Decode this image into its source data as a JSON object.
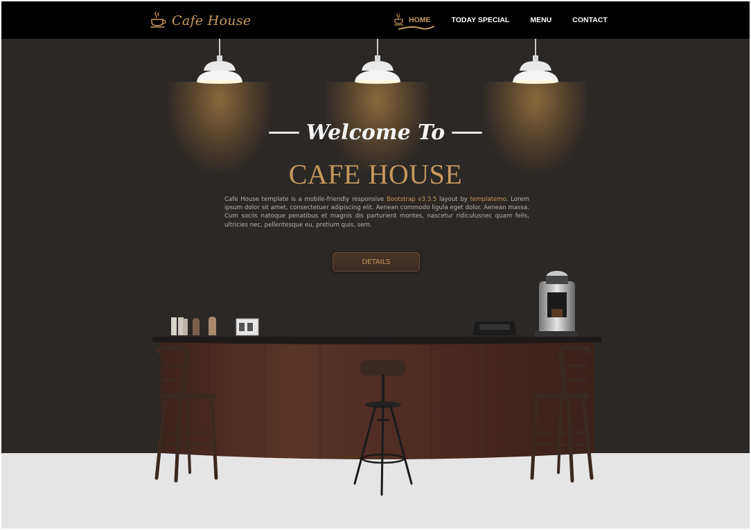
{
  "brand": {
    "name": "Cafe House",
    "icon": "coffee-cup-icon"
  },
  "nav": {
    "items": [
      {
        "label": "HOME",
        "active": true,
        "icon": "coffee-cup-icon"
      },
      {
        "label": "TODAY SPECIAL",
        "active": false
      },
      {
        "label": "MENU",
        "active": false
      },
      {
        "label": "CONTACT",
        "active": false
      }
    ]
  },
  "hero": {
    "welcome": "Welcome To",
    "title": "CAFE HOUSE",
    "desc_part1": "Cafe House template is a mobile-friendly responsive ",
    "desc_link1": "Bootstrap v3.3.5",
    "desc_part2": " layout by ",
    "desc_link2": "templatemo",
    "desc_part3": ". Lorem ipsum dolor sit amet, consectetuer adipiscing elit. Aenean commodo ligula eget dolor. Aenean massa. Cum sociis natoque penatibus et magnis dis parturient montes, nascetur ridiculusnec quam felis, ultricies nec, pellentesque eu, pretium quis, sem.",
    "button_label": "DETAILS"
  },
  "colors": {
    "accent": "#c6985e",
    "background": "#2b2826",
    "navbar": "#000000",
    "floor": "#e6e5e6",
    "counter_wood": "#4a2a20"
  }
}
